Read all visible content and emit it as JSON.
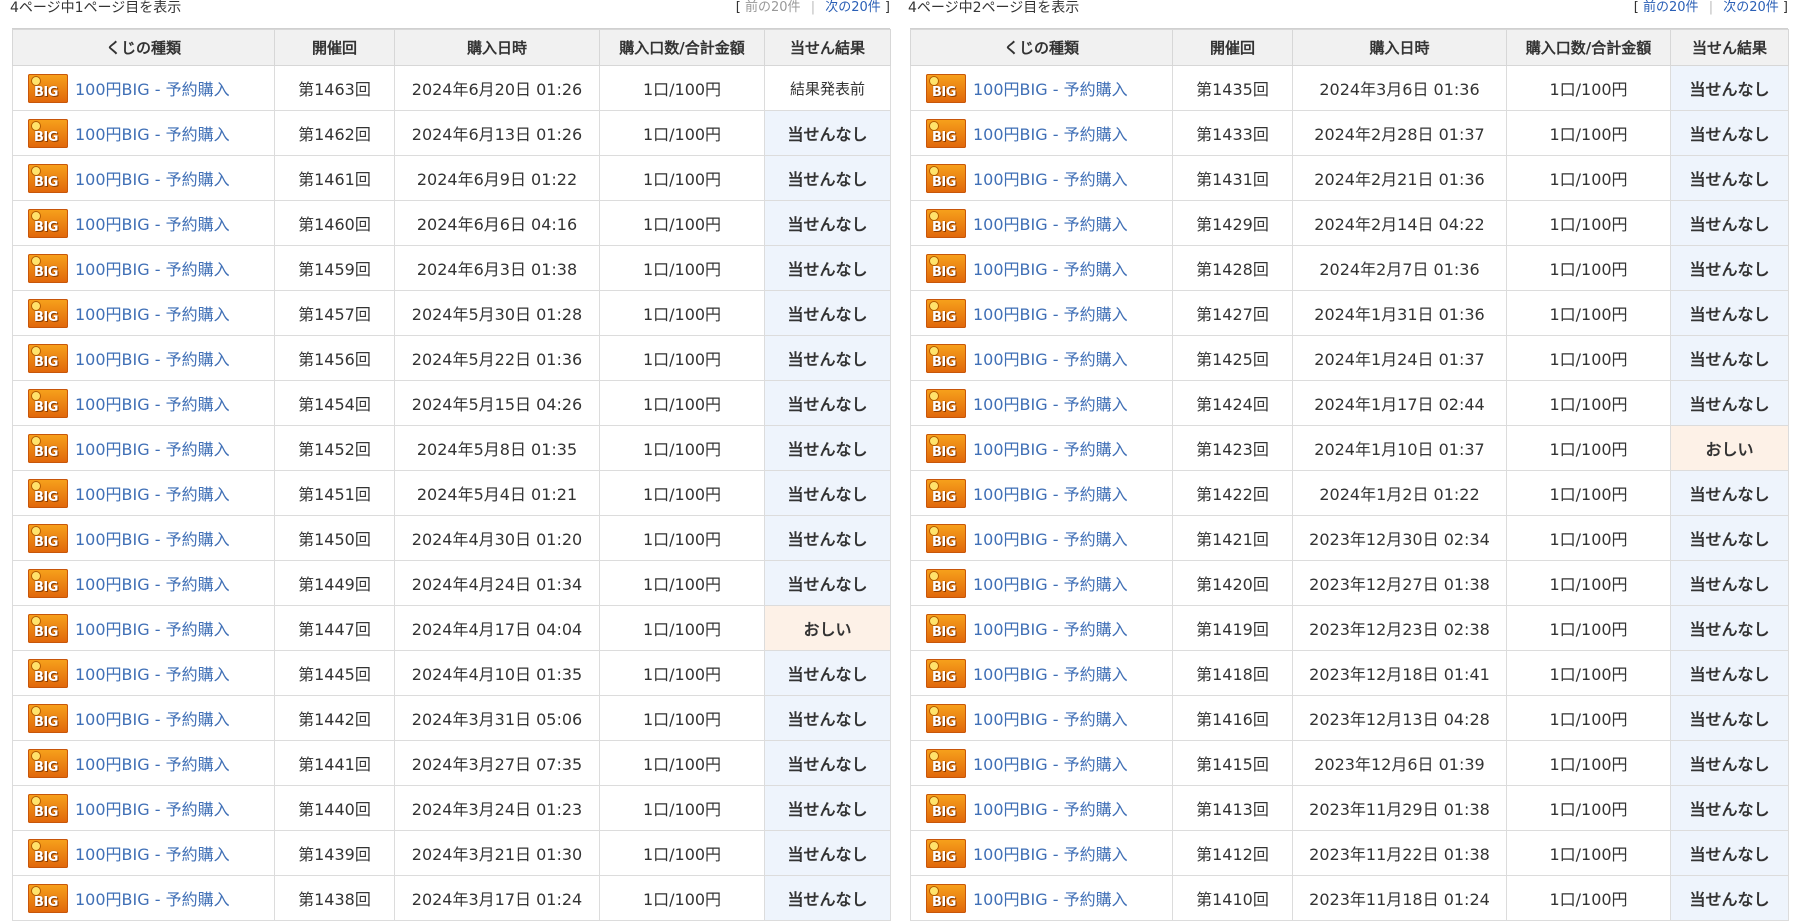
{
  "headers": [
    "くじの種類",
    "開催回",
    "購入日時",
    "購入口数/合計金額",
    "当せん結果"
  ],
  "pages": [
    {
      "page_info": "4ページ中1ページ目を表示",
      "pager": {
        "open": "[",
        "prev": "前の20件",
        "sep": "|",
        "next": "次の20件",
        "close": "]"
      },
      "rows": [
        {
          "lottery": "100円BIG - 予約購入",
          "round": "第1463回",
          "date": "2024年6月20日 01:26",
          "qty": "1口/100円",
          "result": "結果発表前",
          "status": "pending"
        },
        {
          "lottery": "100円BIG - 予約購入",
          "round": "第1462回",
          "date": "2024年6月13日 01:26",
          "qty": "1口/100円",
          "result": "当せんなし",
          "status": "none"
        },
        {
          "lottery": "100円BIG - 予約購入",
          "round": "第1461回",
          "date": "2024年6月9日 01:22",
          "qty": "1口/100円",
          "result": "当せんなし",
          "status": "none"
        },
        {
          "lottery": "100円BIG - 予約購入",
          "round": "第1460回",
          "date": "2024年6月6日 04:16",
          "qty": "1口/100円",
          "result": "当せんなし",
          "status": "none"
        },
        {
          "lottery": "100円BIG - 予約購入",
          "round": "第1459回",
          "date": "2024年6月3日 01:38",
          "qty": "1口/100円",
          "result": "当せんなし",
          "status": "none"
        },
        {
          "lottery": "100円BIG - 予約購入",
          "round": "第1457回",
          "date": "2024年5月30日 01:28",
          "qty": "1口/100円",
          "result": "当せんなし",
          "status": "none"
        },
        {
          "lottery": "100円BIG - 予約購入",
          "round": "第1456回",
          "date": "2024年5月22日 01:36",
          "qty": "1口/100円",
          "result": "当せんなし",
          "status": "none"
        },
        {
          "lottery": "100円BIG - 予約購入",
          "round": "第1454回",
          "date": "2024年5月15日 04:26",
          "qty": "1口/100円",
          "result": "当せんなし",
          "status": "none"
        },
        {
          "lottery": "100円BIG - 予約購入",
          "round": "第1452回",
          "date": "2024年5月8日 01:35",
          "qty": "1口/100円",
          "result": "当せんなし",
          "status": "none"
        },
        {
          "lottery": "100円BIG - 予約購入",
          "round": "第1451回",
          "date": "2024年5月4日 01:21",
          "qty": "1口/100円",
          "result": "当せんなし",
          "status": "none"
        },
        {
          "lottery": "100円BIG - 予約購入",
          "round": "第1450回",
          "date": "2024年4月30日 01:20",
          "qty": "1口/100円",
          "result": "当せんなし",
          "status": "none"
        },
        {
          "lottery": "100円BIG - 予約購入",
          "round": "第1449回",
          "date": "2024年4月24日 01:34",
          "qty": "1口/100円",
          "result": "当せんなし",
          "status": "none"
        },
        {
          "lottery": "100円BIG - 予約購入",
          "round": "第1447回",
          "date": "2024年4月17日 04:04",
          "qty": "1口/100円",
          "result": "おしい",
          "status": "oshii"
        },
        {
          "lottery": "100円BIG - 予約購入",
          "round": "第1445回",
          "date": "2024年4月10日 01:35",
          "qty": "1口/100円",
          "result": "当せんなし",
          "status": "none"
        },
        {
          "lottery": "100円BIG - 予約購入",
          "round": "第1442回",
          "date": "2024年3月31日 05:06",
          "qty": "1口/100円",
          "result": "当せんなし",
          "status": "none"
        },
        {
          "lottery": "100円BIG - 予約購入",
          "round": "第1441回",
          "date": "2024年3月27日 07:35",
          "qty": "1口/100円",
          "result": "当せんなし",
          "status": "none"
        },
        {
          "lottery": "100円BIG - 予約購入",
          "round": "第1440回",
          "date": "2024年3月24日 01:23",
          "qty": "1口/100円",
          "result": "当せんなし",
          "status": "none"
        },
        {
          "lottery": "100円BIG - 予約購入",
          "round": "第1439回",
          "date": "2024年3月21日 01:30",
          "qty": "1口/100円",
          "result": "当せんなし",
          "status": "none"
        },
        {
          "lottery": "100円BIG - 予約購入",
          "round": "第1438回",
          "date": "2024年3月17日 01:24",
          "qty": "1口/100円",
          "result": "当せんなし",
          "status": "none"
        }
      ]
    },
    {
      "page_info": "4ページ中2ページ目を表示",
      "pager": {
        "open": "[",
        "prev": "前の20件",
        "sep": "|",
        "next": "次の20件",
        "close": "]"
      },
      "rows": [
        {
          "lottery": "100円BIG - 予約購入",
          "round": "第1435回",
          "date": "2024年3月6日 01:36",
          "qty": "1口/100円",
          "result": "当せんなし",
          "status": "none"
        },
        {
          "lottery": "100円BIG - 予約購入",
          "round": "第1433回",
          "date": "2024年2月28日 01:37",
          "qty": "1口/100円",
          "result": "当せんなし",
          "status": "none"
        },
        {
          "lottery": "100円BIG - 予約購入",
          "round": "第1431回",
          "date": "2024年2月21日 01:36",
          "qty": "1口/100円",
          "result": "当せんなし",
          "status": "none"
        },
        {
          "lottery": "100円BIG - 予約購入",
          "round": "第1429回",
          "date": "2024年2月14日 04:22",
          "qty": "1口/100円",
          "result": "当せんなし",
          "status": "none"
        },
        {
          "lottery": "100円BIG - 予約購入",
          "round": "第1428回",
          "date": "2024年2月7日 01:36",
          "qty": "1口/100円",
          "result": "当せんなし",
          "status": "none"
        },
        {
          "lottery": "100円BIG - 予約購入",
          "round": "第1427回",
          "date": "2024年1月31日 01:36",
          "qty": "1口/100円",
          "result": "当せんなし",
          "status": "none"
        },
        {
          "lottery": "100円BIG - 予約購入",
          "round": "第1425回",
          "date": "2024年1月24日 01:37",
          "qty": "1口/100円",
          "result": "当せんなし",
          "status": "none"
        },
        {
          "lottery": "100円BIG - 予約購入",
          "round": "第1424回",
          "date": "2024年1月17日 02:44",
          "qty": "1口/100円",
          "result": "当せんなし",
          "status": "none"
        },
        {
          "lottery": "100円BIG - 予約購入",
          "round": "第1423回",
          "date": "2024年1月10日 01:37",
          "qty": "1口/100円",
          "result": "おしい",
          "status": "oshii"
        },
        {
          "lottery": "100円BIG - 予約購入",
          "round": "第1422回",
          "date": "2024年1月2日 01:22",
          "qty": "1口/100円",
          "result": "当せんなし",
          "status": "none"
        },
        {
          "lottery": "100円BIG - 予約購入",
          "round": "第1421回",
          "date": "2023年12月30日 02:34",
          "qty": "1口/100円",
          "result": "当せんなし",
          "status": "none"
        },
        {
          "lottery": "100円BIG - 予約購入",
          "round": "第1420回",
          "date": "2023年12月27日 01:38",
          "qty": "1口/100円",
          "result": "当せんなし",
          "status": "none"
        },
        {
          "lottery": "100円BIG - 予約購入",
          "round": "第1419回",
          "date": "2023年12月23日 02:38",
          "qty": "1口/100円",
          "result": "当せんなし",
          "status": "none"
        },
        {
          "lottery": "100円BIG - 予約購入",
          "round": "第1418回",
          "date": "2023年12月18日 01:41",
          "qty": "1口/100円",
          "result": "当せんなし",
          "status": "none"
        },
        {
          "lottery": "100円BIG - 予約購入",
          "round": "第1416回",
          "date": "2023年12月13日 04:28",
          "qty": "1口/100円",
          "result": "当せんなし",
          "status": "none"
        },
        {
          "lottery": "100円BIG - 予約購入",
          "round": "第1415回",
          "date": "2023年12月6日 01:39",
          "qty": "1口/100円",
          "result": "当せんなし",
          "status": "none"
        },
        {
          "lottery": "100円BIG - 予約購入",
          "round": "第1413回",
          "date": "2023年11月29日 01:38",
          "qty": "1口/100円",
          "result": "当せんなし",
          "status": "none"
        },
        {
          "lottery": "100円BIG - 予約購入",
          "round": "第1412回",
          "date": "2023年11月22日 01:38",
          "qty": "1口/100円",
          "result": "当せんなし",
          "status": "none"
        },
        {
          "lottery": "100円BIG - 予約購入",
          "round": "第1410回",
          "date": "2023年11月18日 01:24",
          "qty": "1口/100円",
          "result": "当せんなし",
          "status": "none"
        }
      ]
    }
  ],
  "logo": {
    "icon": "big-lottery-logo-icon",
    "text": "BIG"
  },
  "colors": {
    "link": "#3f6fb6",
    "header_bg": "#f1f1f1",
    "result_none_bg": "#eef4fc",
    "result_oshii_bg": "#fdf1e7",
    "logo_orange": "#f08a12"
  }
}
